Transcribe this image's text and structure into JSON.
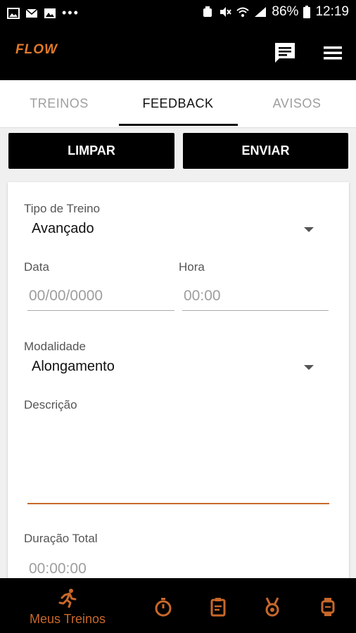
{
  "status": {
    "battery": "86%",
    "time": "12:19"
  },
  "app": {
    "logo": "FLOW"
  },
  "tabs": [
    {
      "label": "TREINOS"
    },
    {
      "label": "FEEDBACK"
    },
    {
      "label": "AVISOS"
    }
  ],
  "actions": {
    "clear": "LIMPAR",
    "send": "ENVIAR"
  },
  "form": {
    "tipo_label": "Tipo de Treino",
    "tipo_value": "Avançado",
    "data_label": "Data",
    "data_placeholder": "00/00/0000",
    "hora_label": "Hora",
    "hora_placeholder": "00:00",
    "modalidade_label": "Modalidade",
    "modalidade_value": "Alongamento",
    "descricao_label": "Descrição",
    "duracao_label": "Duração Total",
    "duracao_placeholder": "00:00:00"
  },
  "bottom_nav": {
    "active_label": "Meus Treinos",
    "items": [
      "runner-icon",
      "stopwatch-icon",
      "clipboard-icon",
      "medal-icon",
      "watch-icon"
    ]
  },
  "colors": {
    "accent": "#c8682a",
    "bar": "#000000"
  }
}
